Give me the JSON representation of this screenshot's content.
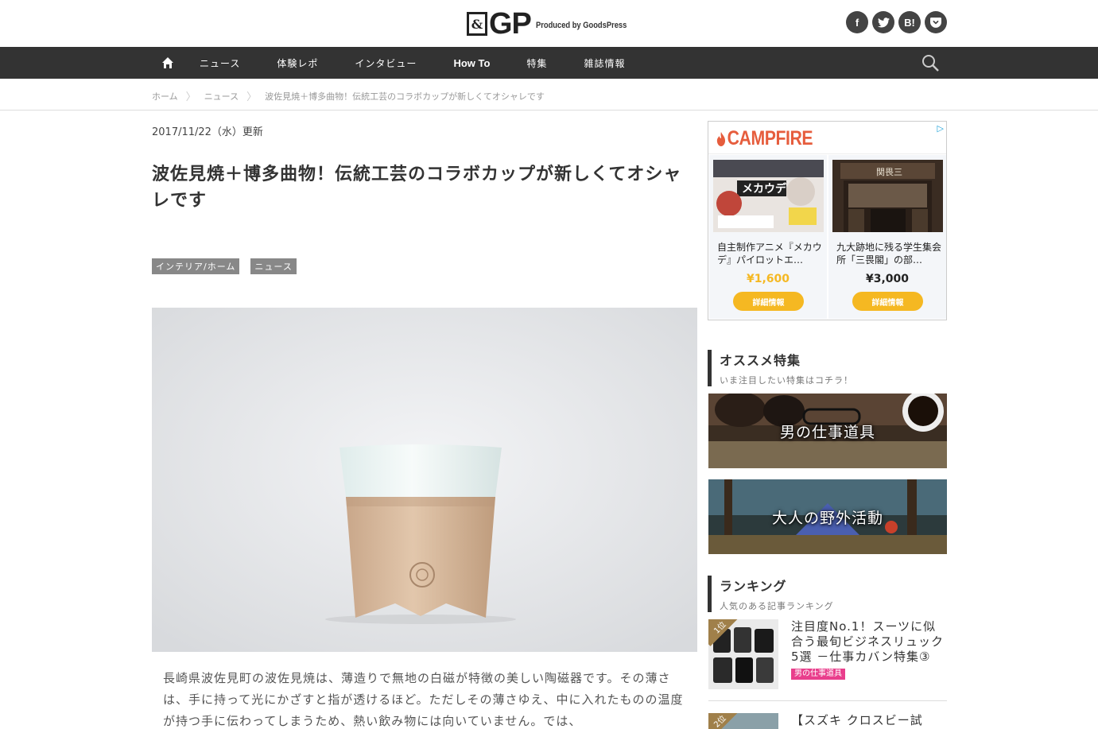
{
  "header": {
    "logo_mark": "&",
    "logo_text": "GP",
    "logo_tagline": "Produced by GoodsPress",
    "social": [
      "f",
      "t",
      "B!",
      "♥"
    ],
    "social_icons": [
      "facebook-icon",
      "twitter-icon",
      "hatena-bookmark-icon",
      "pocket-icon"
    ]
  },
  "nav": {
    "items": [
      "ニュース",
      "体験レポ",
      "インタビュー",
      "How To",
      "特集",
      "雑誌情報"
    ]
  },
  "breadcrumb": [
    "ホーム",
    "ニュース",
    "波佐見焼＋博多曲物！伝統工芸のコラボカップが新しくてオシャレです"
  ],
  "article": {
    "date": "2017/11/22（水）更新",
    "title": "波佐見焼＋博多曲物！伝統工芸のコラボカップが新しくてオシャレです",
    "tags": [
      "インテリア/ホーム",
      "ニュース"
    ],
    "body": "長崎県波佐見町の波佐見焼は、薄造りで無地の白磁が特徴の美しい陶磁器です。その薄さは、手に持って光にかざすと指が透けるほど。ただしその薄さゆえ、中に入れたものの温度が持つ手に伝わってしまうため、熱い飲み物には向いていません。では、"
  },
  "ad": {
    "brand": "CAMPFIRE",
    "items": [
      {
        "text": "自主制作アニメ『メカウデ』パイロットエ…",
        "price": "¥1,600",
        "price_color": "#f5b822",
        "button": "詳細情報"
      },
      {
        "text": "九大跡地に残る学生集会所「三畏閣」の部…",
        "price": "¥3,000",
        "price_color": "#222222",
        "button": "詳細情報"
      }
    ]
  },
  "features": {
    "title": "オススメ特集",
    "subtitle": "いま注目したい特集はコチラ！",
    "banners": [
      "男の仕事道具",
      "大人の野外活動"
    ]
  },
  "ranking": {
    "title": "ランキング",
    "subtitle": "人気のある記事ランキング",
    "items": [
      {
        "rank": "1位",
        "text": "注目度No.1！スーツに似合う最旬ビジネスリュック5選 －仕事カバン特集③",
        "label": "男の仕事道具"
      },
      {
        "rank": "2位",
        "text": "【スズキ クロスビー試",
        "label": ""
      }
    ]
  }
}
